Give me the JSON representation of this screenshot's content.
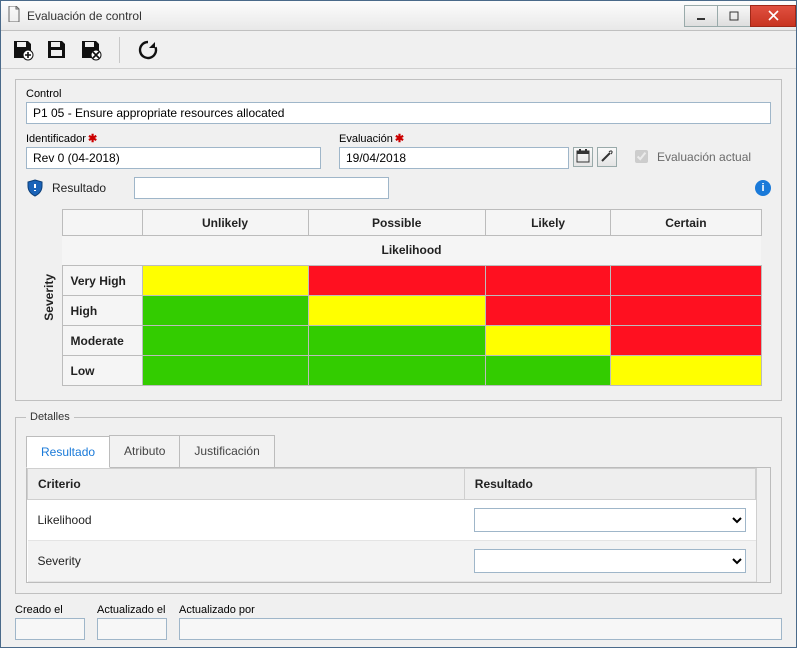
{
  "window": {
    "title": "Evaluación de control"
  },
  "form": {
    "control": {
      "label": "Control",
      "value": "P1 05 - Ensure appropriate resources allocated"
    },
    "ident": {
      "label": "Identificador",
      "required": true,
      "value": "Rev 0 (04-2018)"
    },
    "eval": {
      "label": "Evaluación",
      "required": true,
      "value": "19/04/2018"
    },
    "current": {
      "label": "Evaluación actual",
      "checked": true
    },
    "resultado": {
      "label": "Resultado",
      "value": ""
    }
  },
  "matrix": {
    "x_axis_title": "Likelihood",
    "y_axis_title": "Severity",
    "columns": [
      "Unlikely",
      "Possible",
      "Likely",
      "Certain"
    ],
    "rows": [
      "Very High",
      "High",
      "Moderate",
      "Low"
    ],
    "colors": [
      [
        "yellow",
        "red",
        "red",
        "red"
      ],
      [
        "green",
        "yellow",
        "red",
        "red"
      ],
      [
        "green",
        "green",
        "yellow",
        "red"
      ],
      [
        "green",
        "green",
        "green",
        "yellow"
      ]
    ]
  },
  "detalles": {
    "legend": "Detalles",
    "tabs": [
      {
        "id": "resultado",
        "label": "Resultado",
        "active": true
      },
      {
        "id": "atributo",
        "label": "Atributo",
        "active": false
      },
      {
        "id": "justificacion",
        "label": "Justificación",
        "active": false
      }
    ],
    "criteria": {
      "headers": {
        "criterio": "Criterio",
        "resultado": "Resultado"
      },
      "rows": [
        {
          "label": "Likelihood",
          "value": ""
        },
        {
          "label": "Severity",
          "value": ""
        }
      ]
    }
  },
  "footer": {
    "creado": {
      "label": "Creado el",
      "value": ""
    },
    "actualizado": {
      "label": "Actualizado el",
      "value": ""
    },
    "actualizado_por": {
      "label": "Actualizado por",
      "value": ""
    }
  }
}
